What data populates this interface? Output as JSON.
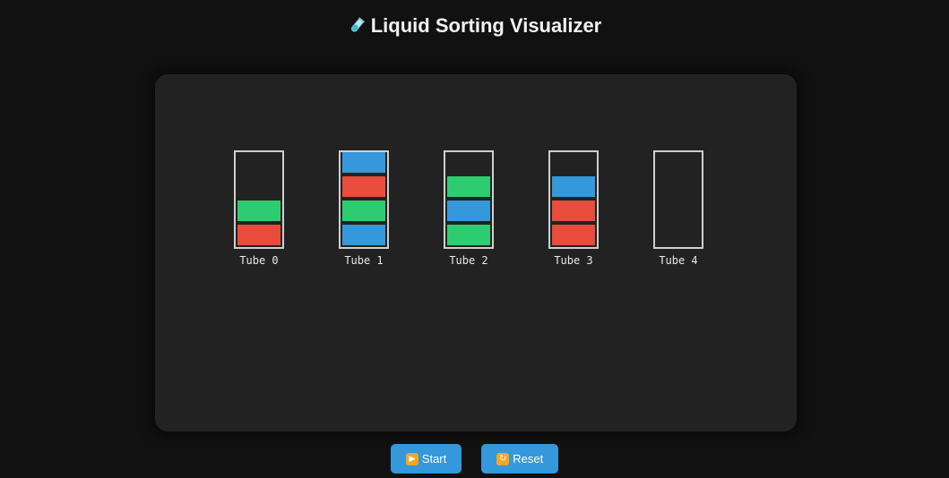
{
  "header": {
    "icon": "test-tube-icon",
    "title": "Liquid Sorting Visualizer"
  },
  "colors": {
    "background": "#111111",
    "board": "#222222",
    "tube_border": "#cfcfcf",
    "red": "#e74c3c",
    "green": "#2ecc71",
    "blue": "#3498db",
    "button": "#3498db"
  },
  "tube_capacity": 4,
  "tubes": [
    {
      "label": "Tube 0",
      "layers": [
        "red",
        "green"
      ]
    },
    {
      "label": "Tube 1",
      "layers": [
        "blue",
        "green",
        "red",
        "blue"
      ]
    },
    {
      "label": "Tube 2",
      "layers": [
        "green",
        "blue",
        "green"
      ]
    },
    {
      "label": "Tube 3",
      "layers": [
        "red",
        "red",
        "blue"
      ]
    },
    {
      "label": "Tube 4",
      "layers": []
    }
  ],
  "controls": {
    "start_label": "Start",
    "start_icon": "play-icon",
    "reset_label": "Reset",
    "reset_icon": "repeat-icon"
  }
}
